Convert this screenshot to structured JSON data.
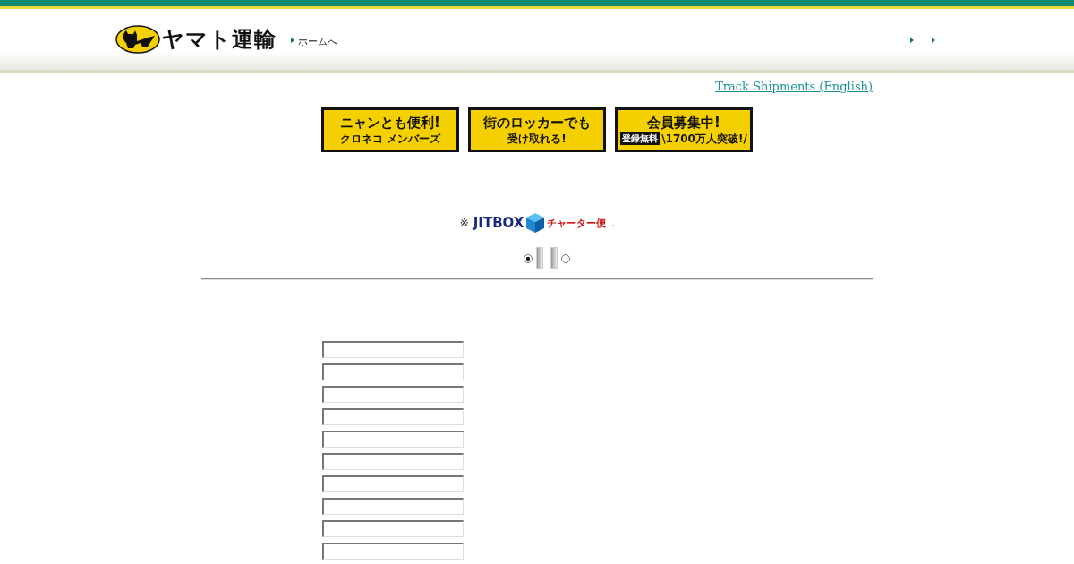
{
  "header": {
    "logo_text": "ヤマト運輸",
    "home_link": "ホームへ",
    "nav_links": [
      {
        "kind": "arrow"
      },
      {
        "kind": "arrow"
      }
    ]
  },
  "english_link": "Track Shipments (English)",
  "banners": [
    {
      "line1": "ニャンとも便利!",
      "line2": "クロネコ メンバーズ"
    },
    {
      "line1": "街のロッカーでも",
      "line2": "受け取れる!"
    },
    {
      "line1": "会員募集中!",
      "tag": "登録無料",
      "line2": "\\1700万人突破!/"
    }
  ],
  "notice": {
    "mark": "※",
    "brand": "JITBOX",
    "suffix": "チャーター便",
    "tail": "."
  },
  "radios": [
    {
      "selected": true
    },
    {
      "selected": false
    }
  ],
  "fields": [
    {
      "kind": "text"
    },
    {
      "kind": "text"
    },
    {
      "kind": "text"
    },
    {
      "kind": "text"
    },
    {
      "kind": "text"
    },
    {
      "kind": "text"
    },
    {
      "kind": "text"
    },
    {
      "kind": "text"
    },
    {
      "kind": "text"
    },
    {
      "kind": "text"
    }
  ]
}
